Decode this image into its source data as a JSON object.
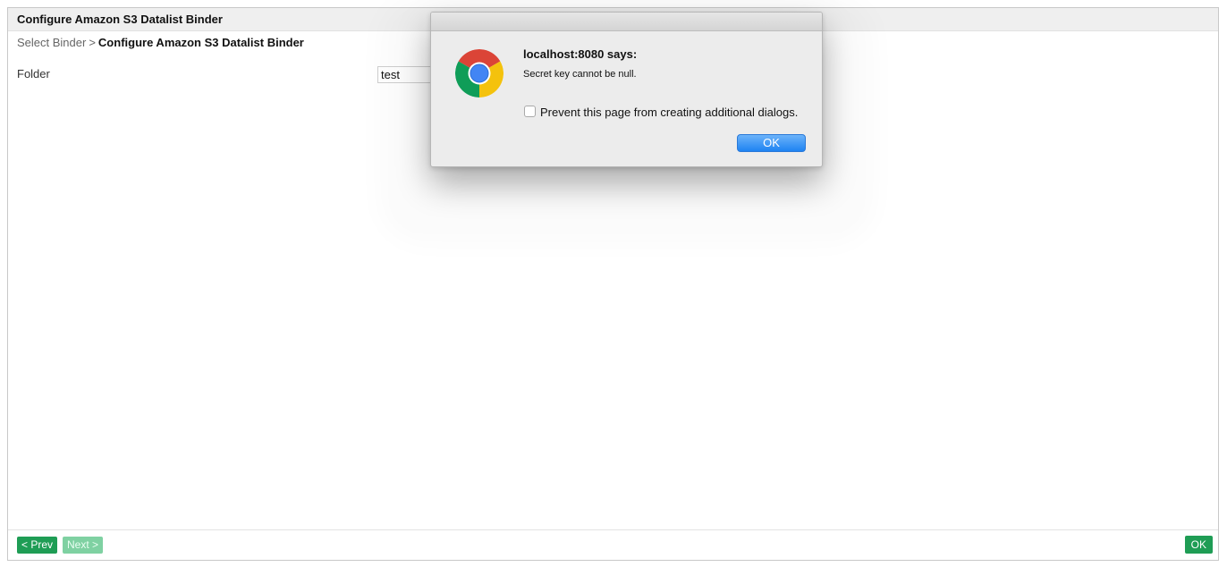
{
  "page": {
    "title": "Configure Amazon S3 Datalist Binder",
    "breadcrumb": {
      "parent": "Select Binder",
      "separator": ">",
      "current": "Configure Amazon S3 Datalist Binder"
    },
    "form": {
      "folder_label": "Folder",
      "folder_value": "test"
    },
    "footer": {
      "prev_label": "< Prev",
      "next_label": "Next >",
      "ok_label": "OK"
    },
    "colors": {
      "primary_button": "#1f9d55",
      "disabled_button": "#7fd1a2"
    }
  },
  "dialog": {
    "icon": "chrome-logo-icon",
    "title": "localhost:8080 says:",
    "message": "Secret key cannot be null.",
    "checkbox_label": "Prevent this page from creating additional dialogs.",
    "checkbox_checked": false,
    "ok_label": "OK",
    "colors": {
      "ok_button": "#1e83f2"
    }
  }
}
